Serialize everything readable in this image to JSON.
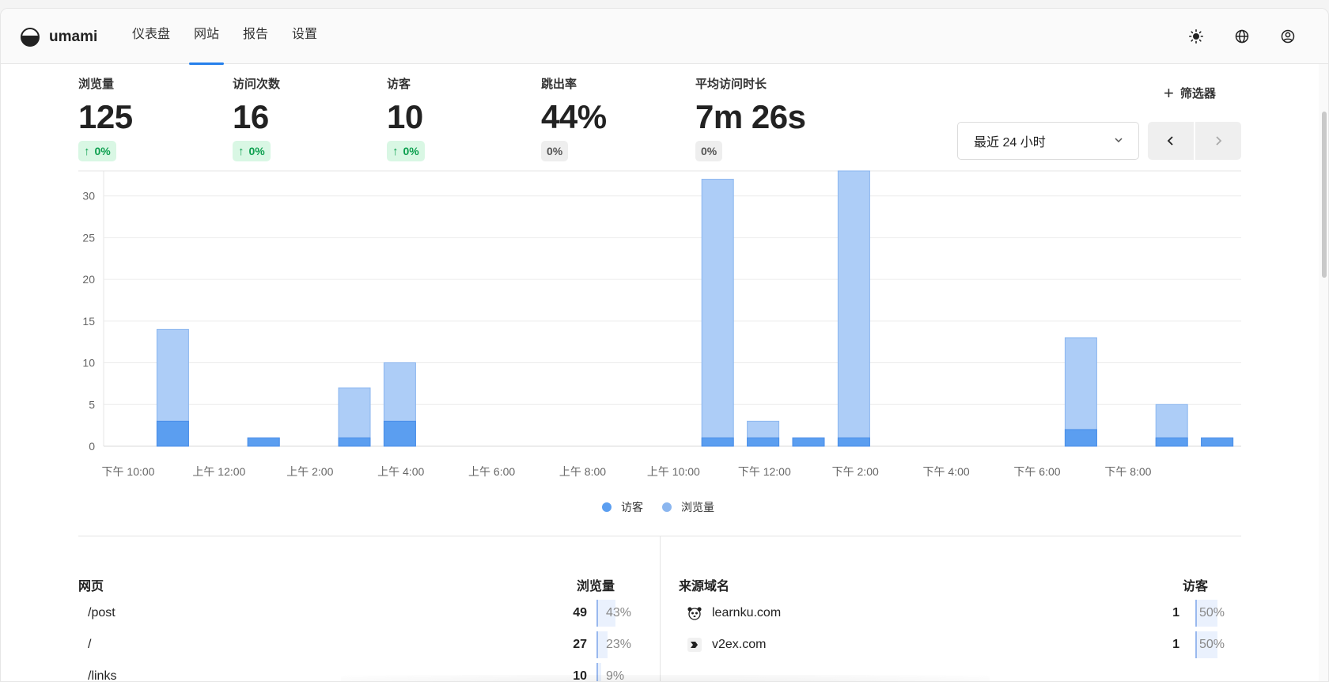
{
  "app": {
    "name": "umami"
  },
  "nav": {
    "items": [
      {
        "label": "仪表盘",
        "active": false
      },
      {
        "label": "网站",
        "active": true
      },
      {
        "label": "报告",
        "active": false
      },
      {
        "label": "设置",
        "active": false
      }
    ]
  },
  "top_actions": [
    "sun-icon",
    "globe-icon",
    "user-icon"
  ],
  "metrics": [
    {
      "label": "浏览量",
      "value": "125",
      "change": "0%",
      "trend": "up"
    },
    {
      "label": "访问次数",
      "value": "16",
      "change": "0%",
      "trend": "up"
    },
    {
      "label": "访客",
      "value": "10",
      "change": "0%",
      "trend": "up"
    },
    {
      "label": "跳出率",
      "value": "44%",
      "change": "0%",
      "trend": "flat"
    },
    {
      "label": "平均访问时长",
      "value": "7m 26s",
      "change": "0%",
      "trend": "flat"
    }
  ],
  "filter": {
    "label": "筛选器"
  },
  "date_range": {
    "selected": "最近 24 小时"
  },
  "colors": {
    "accent": "#2680eb",
    "visitors": "#5b9ef0",
    "views": "#adcdf7",
    "views_stroke": "#8bb6ef",
    "up_bg": "#d9f7e4",
    "up_text": "#0d9f4f"
  },
  "chart_data": {
    "type": "bar",
    "stacked": true,
    "ylim": [
      0,
      33
    ],
    "yticks": [
      0,
      5,
      10,
      15,
      20,
      25,
      30
    ],
    "xtick_labels": [
      "下午 10:00",
      "上午 12:00",
      "上午 2:00",
      "上午 4:00",
      "上午 6:00",
      "上午 8:00",
      "上午 10:00",
      "下午 12:00",
      "下午 2:00",
      "下午 4:00",
      "下午 6:00",
      "下午 8:00"
    ],
    "slot_count": 25,
    "series": [
      {
        "name": "访客",
        "values": [
          0,
          3,
          0,
          1,
          0,
          1,
          3,
          0,
          0,
          0,
          0,
          0,
          0,
          1,
          1,
          1,
          1,
          0,
          0,
          0,
          0,
          2,
          0,
          1,
          1
        ]
      },
      {
        "name": "浏览量",
        "values": [
          0,
          14,
          0,
          1,
          0,
          7,
          10,
          0,
          0,
          0,
          0,
          0,
          0,
          32,
          3,
          1,
          33,
          0,
          0,
          0,
          0,
          13,
          0,
          5,
          1
        ]
      }
    ],
    "legend": "bottom-center",
    "grid": true
  },
  "pages_panel": {
    "title": "网页",
    "metric_label": "浏览量",
    "rows": [
      {
        "label": "/post",
        "value": "49",
        "percent": "43%",
        "fraction": 0.43
      },
      {
        "label": "/",
        "value": "27",
        "percent": "23%",
        "fraction": 0.23
      },
      {
        "label": "/links",
        "value": "10",
        "percent": "9%",
        "fraction": 0.09
      }
    ]
  },
  "referrers_panel": {
    "title": "来源域名",
    "metric_label": "访客",
    "rows": [
      {
        "label": "learnku.com",
        "icon": "learnku-favicon",
        "value": "1",
        "percent": "50%",
        "fraction": 0.5
      },
      {
        "label": "v2ex.com",
        "icon": "v2ex-favicon",
        "value": "1",
        "percent": "50%",
        "fraction": 0.5
      }
    ]
  }
}
